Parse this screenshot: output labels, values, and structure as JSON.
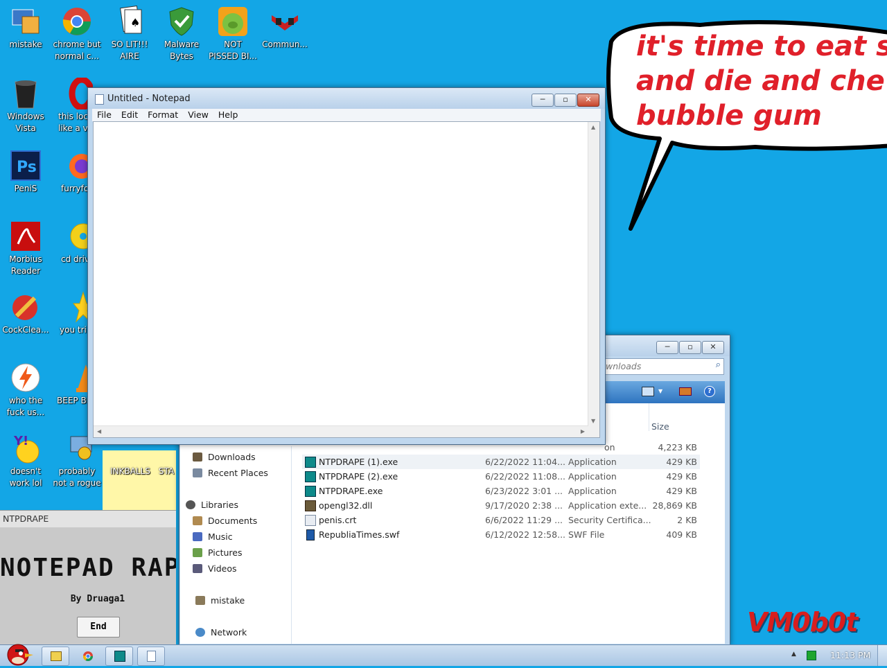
{
  "desktop": {
    "icons": [
      {
        "label": "mistake"
      },
      {
        "label": "chrome but normal c..."
      },
      {
        "label": "SO LIT!!! AIRE"
      },
      {
        "label": "Malware Bytes"
      },
      {
        "label": "NOT PISSED BI..."
      },
      {
        "label": "Commun..."
      },
      {
        "label": "Windows Vista"
      },
      {
        "label": "this loc like a v"
      },
      {
        "label": "PeniS"
      },
      {
        "label": "furryfo"
      },
      {
        "label": "Morbius Reader"
      },
      {
        "label": "cd driv"
      },
      {
        "label": "CockClea..."
      },
      {
        "label": "you tri"
      },
      {
        "label": "who the fuck us..."
      },
      {
        "label": "BEEP BE"
      },
      {
        "label": "doesn't work lol"
      },
      {
        "label": "probably not a rogue"
      },
      {
        "label": "INKBALLS"
      },
      {
        "label": "STA"
      }
    ],
    "bubble_lines": [
      "it's time to eat shi",
      "and die and chew",
      "bubble gum"
    ],
    "signature": "VM0b0t"
  },
  "notepad": {
    "title": "Untitled - Notepad",
    "menu": [
      "File",
      "Edit",
      "Format",
      "View",
      "Help"
    ],
    "content": ""
  },
  "explorer": {
    "search_placeholder": "wnloads",
    "col_size": "Size",
    "partial_type": "on",
    "partial_size": "4,223 KB",
    "nav": {
      "downloads": "Downloads",
      "recent": "Recent Places",
      "libraries": "Libraries",
      "documents": "Documents",
      "music": "Music",
      "pictures": "Pictures",
      "videos": "Videos",
      "mistake": "mistake",
      "network": "Network"
    },
    "files": [
      {
        "name": "NTPDRAPE (1).exe",
        "date": "6/22/2022 11:04...",
        "type": "Application",
        "size": "429 KB"
      },
      {
        "name": "NTPDRAPE (2).exe",
        "date": "6/22/2022 11:08...",
        "type": "Application",
        "size": "429 KB"
      },
      {
        "name": "NTPDRAPE.exe",
        "date": "6/23/2022 3:01 ...",
        "type": "Application",
        "size": "429 KB"
      },
      {
        "name": "opengl32.dll",
        "date": "9/17/2020 2:38 ...",
        "type": "Application exte...",
        "size": "28,869 KB"
      },
      {
        "name": "penis.crt",
        "date": "6/6/2022 11:29 ...",
        "type": "Security Certifica...",
        "size": "2 KB"
      },
      {
        "name": "RepubliaTimes.swf",
        "date": "6/12/2022 12:58...",
        "type": "SWF File",
        "size": "409 KB"
      }
    ]
  },
  "ntpdrape": {
    "title": "NTPDRAPE",
    "banner": "NOTEPAD RAPE",
    "byline": "By Druaga1",
    "end_button": "End"
  },
  "taskbar": {
    "clock": "11:13 PM"
  }
}
